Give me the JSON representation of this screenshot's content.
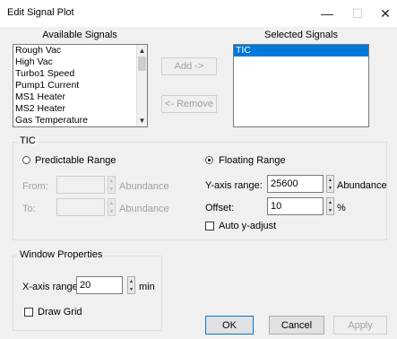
{
  "window": {
    "title": "Edit Signal Plot"
  },
  "available_signals": {
    "label": "Available Signals",
    "items": [
      "Rough Vac",
      "High Vac",
      "Turbo1 Speed",
      "Pump1 Current",
      "MS1 Heater",
      "MS2 Heater",
      "Gas Temperature"
    ]
  },
  "selected_signals": {
    "label": "Selected Signals",
    "items": [
      "TIC"
    ]
  },
  "buttons": {
    "add": "Add ->",
    "remove": "<- Remove",
    "ok": "OK",
    "cancel": "Cancel",
    "apply": "Apply"
  },
  "tic_group": {
    "title": "TIC",
    "predictable_range": "Predictable Range",
    "floating_range": "Floating Range",
    "from_label": "From:",
    "to_label": "To:",
    "from_unit": "Abundance",
    "to_unit": "Abundance",
    "y_axis_label": "Y-axis range:",
    "y_axis_value": "25600",
    "y_axis_unit": "Abundance",
    "offset_label": "Offset:",
    "offset_value": "10",
    "offset_unit": "%",
    "auto_adjust": "Auto y-adjust"
  },
  "window_properties": {
    "title": "Window Properties",
    "x_axis_label": "X-axis range:",
    "x_axis_value": "20",
    "x_axis_unit": "min",
    "draw_grid": "Draw Grid"
  }
}
